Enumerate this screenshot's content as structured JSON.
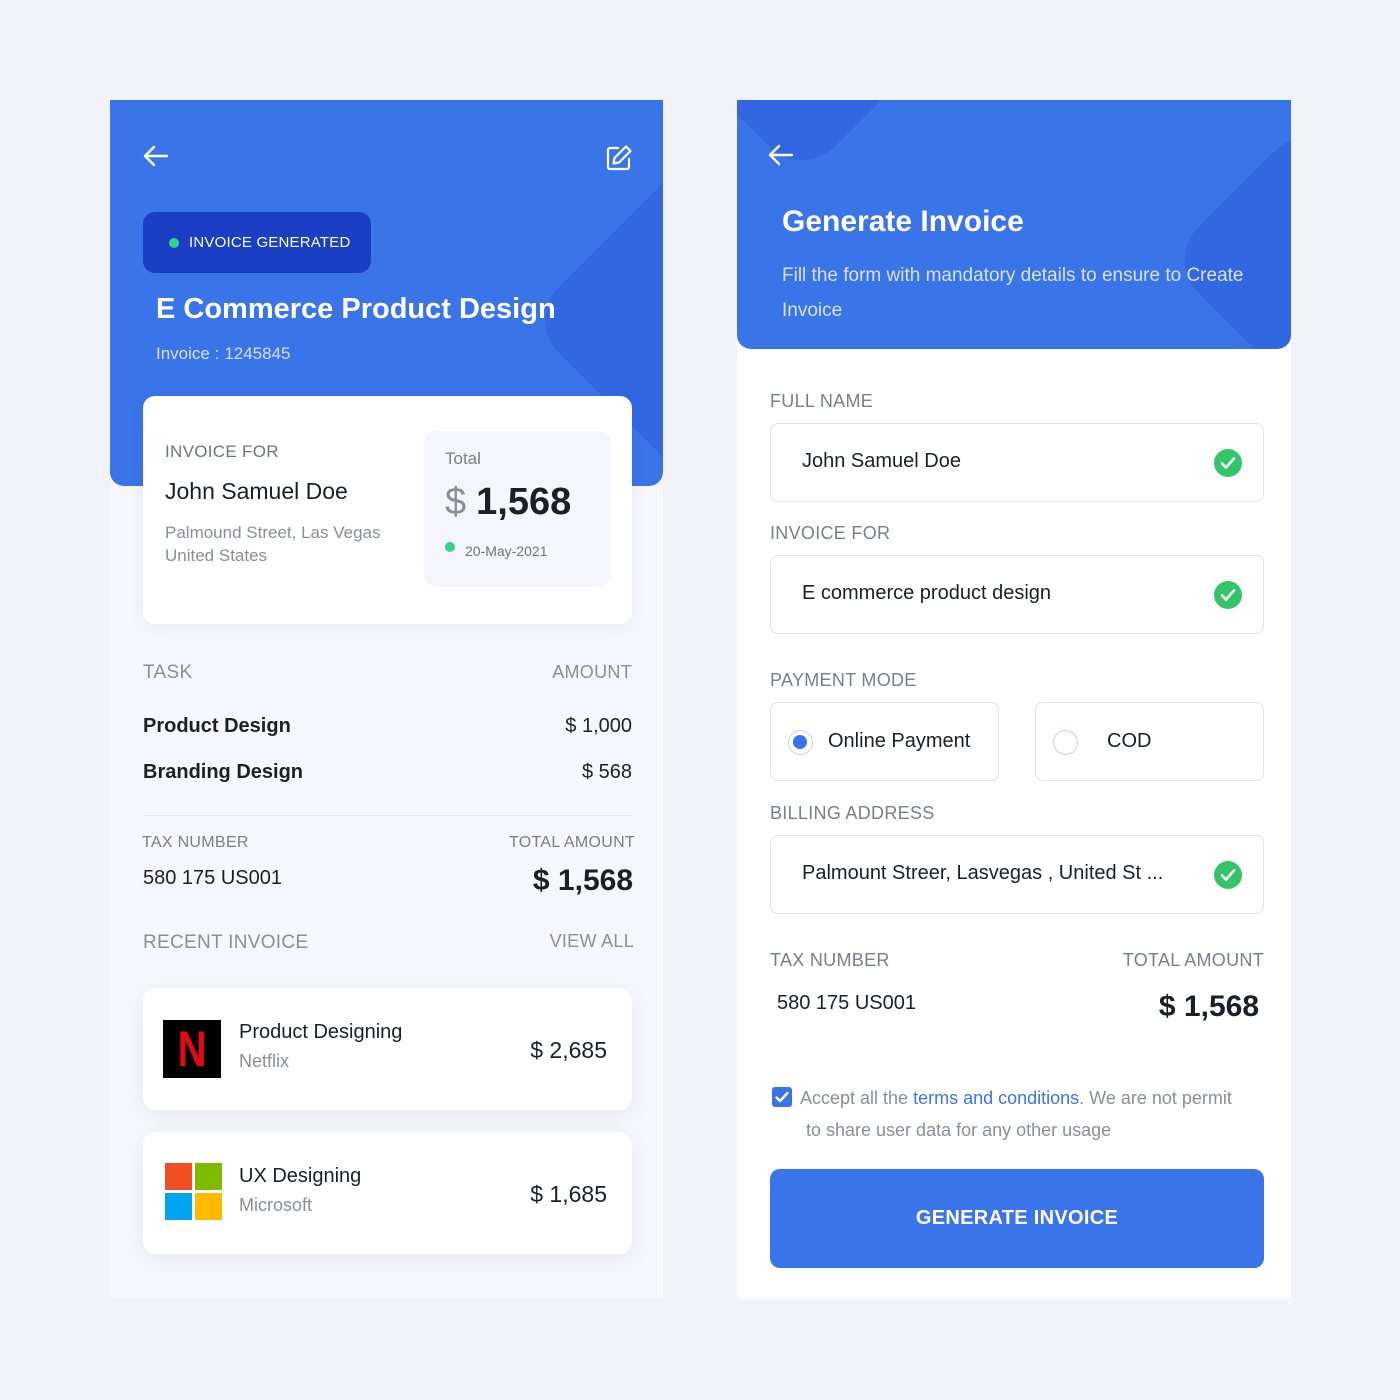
{
  "invoice_detail": {
    "status_badge": "INVOICE GENERATED",
    "project_title": "E Commerce Product Design",
    "invoice_label": "Invoice :",
    "invoice_number": "1245845",
    "invoice_for_label": "INVOICE FOR",
    "client_name": "John Samuel Doe",
    "address_line1": "Palmound Street, Las Vegas",
    "address_line2": "United States",
    "total_label": "Total",
    "currency_symbol": "$",
    "total_value": "1,568",
    "date": "20-May-2021",
    "task_header": "TASK",
    "amount_header": "AMOUNT",
    "tasks": [
      {
        "name": "Product Design",
        "amount": "$ 1,000"
      },
      {
        "name": "Branding Design",
        "amount": "$ 568"
      }
    ],
    "tax_number_label": "TAX NUMBER",
    "tax_number": "580 175 US001",
    "total_amount_label": "TOTAL AMOUNT",
    "total_amount": "$ 1,568",
    "recent_invoice_label": "RECENT INVOICE",
    "view_all_label": "VIEW ALL",
    "recent_invoices": [
      {
        "title": "Product Designing",
        "company": "Netflix",
        "amount": "$ 2,685",
        "logo_letter": "N"
      },
      {
        "title": "UX Designing",
        "company": "Microsoft",
        "amount": "$ 1,685"
      }
    ]
  },
  "generate_form": {
    "title": "Generate Invoice",
    "subtitle": "Fill the form with mandatory details to ensure to Create Invoice",
    "full_name_label": "FULL NAME",
    "full_name_value": "John Samuel Doe",
    "invoice_for_label": "INVOICE FOR",
    "invoice_for_value": "E commerce product design",
    "payment_mode_label": "PAYMENT MODE",
    "payment_options": [
      {
        "label": "Online Payment",
        "selected": true
      },
      {
        "label": "COD",
        "selected": false
      }
    ],
    "billing_address_label": "BILLING ADDRESS",
    "billing_address_value": "Palmount Streer, Lasvegas , United St ...",
    "tax_number_label": "TAX NUMBER",
    "tax_number": "580 175 US001",
    "total_amount_label": "TOTAL AMOUNT",
    "total_amount": "$ 1,568",
    "terms_prefix": "Accept all the",
    "terms_link": "terms and conditions",
    "terms_suffix_line1": ". We are not permit",
    "terms_line2": "to share user data for any other usage",
    "terms_accepted": true,
    "submit_label": "GENERATE INVOICE"
  },
  "icons": {
    "back": "arrow-left-icon",
    "edit": "edit-icon",
    "valid": "check-circle-icon"
  },
  "colors": {
    "primary": "#3a74e9",
    "badge": "#1b3fc4",
    "success": "#34c56a",
    "status_dot": "#34d28a",
    "background": "#f1f2fa"
  }
}
